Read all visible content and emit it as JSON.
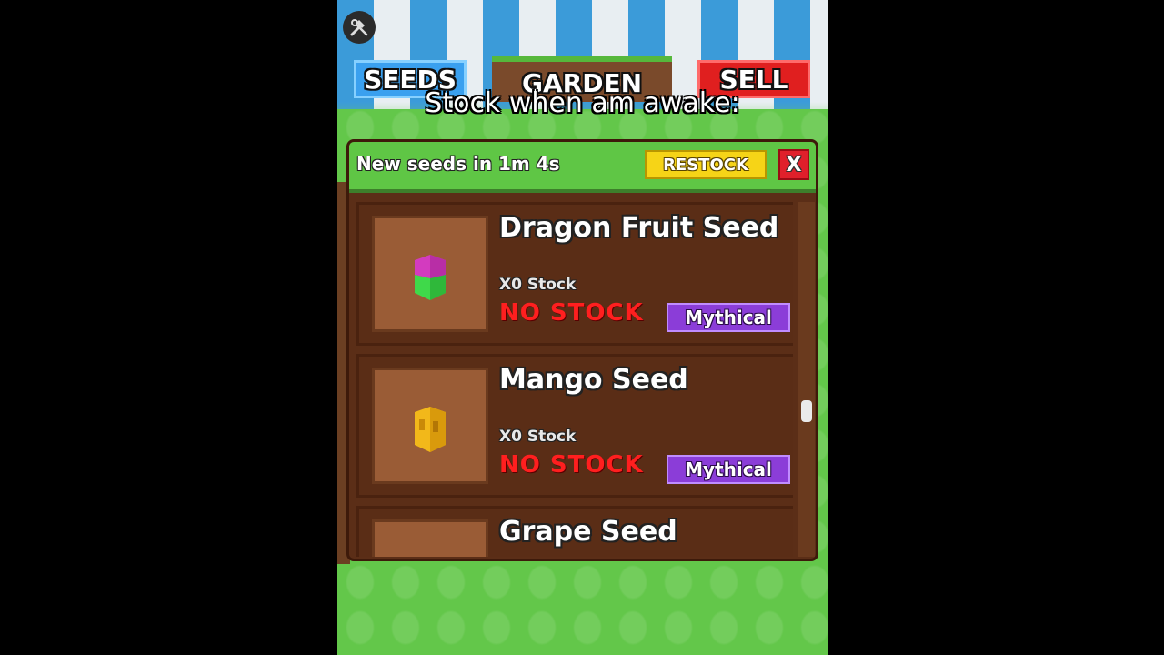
{
  "top_nav": {
    "seeds_label": "SEEDS",
    "garden_label": "GARDEN",
    "sell_label": "SELL"
  },
  "caption": "Stock when am awake:",
  "shop": {
    "timer_text": "New seeds in 1m 4s",
    "restock_label": "RESTOCK",
    "close_label": "X",
    "items": [
      {
        "name": "Dragon Fruit Seed",
        "stock": "X0 Stock",
        "status": "NO STOCK",
        "rarity": "Mythical",
        "icon": "dragon-fruit-seed-icon"
      },
      {
        "name": "Mango Seed",
        "stock": "X0 Stock",
        "status": "NO STOCK",
        "rarity": "Mythical",
        "icon": "mango-seed-icon"
      },
      {
        "name": "Grape Seed",
        "icon": "grape-seed-icon"
      }
    ]
  },
  "colors": {
    "no_stock": "#ff1f1f",
    "mythical": "#8b3dd8",
    "restock": "#f6d417",
    "close": "#e0202b",
    "panel_header": "#5fc645",
    "panel_body": "#5b2e17"
  }
}
